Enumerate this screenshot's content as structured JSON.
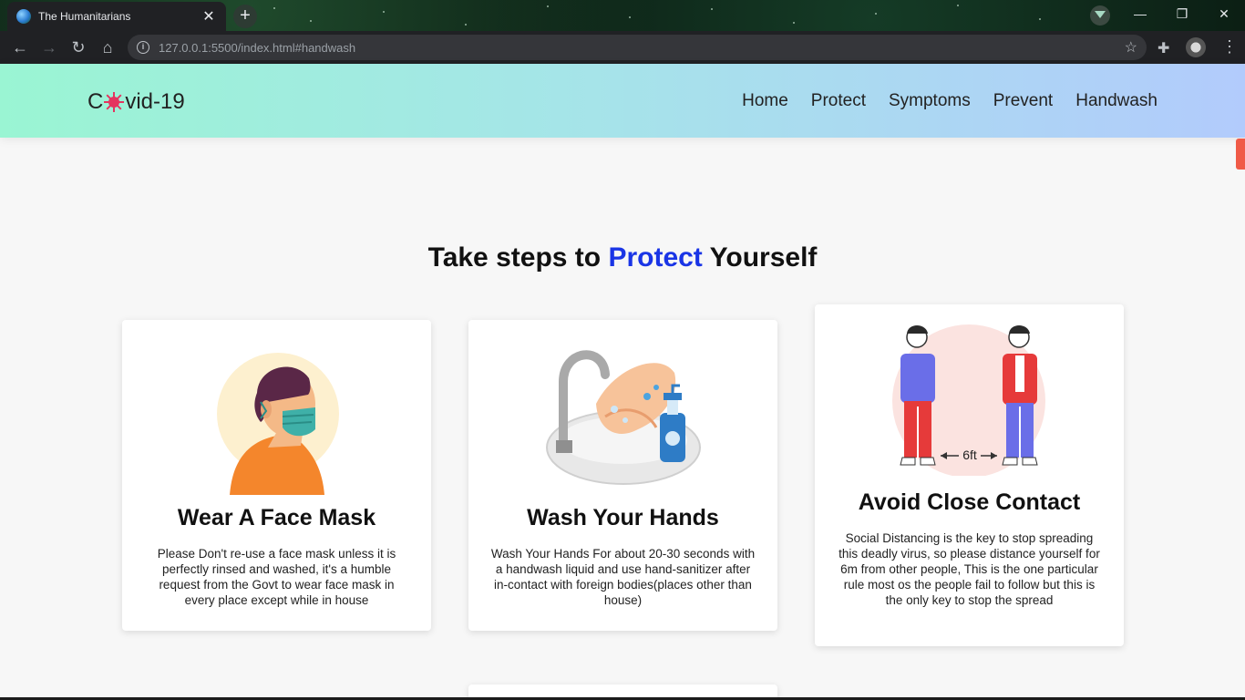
{
  "browser": {
    "tab_title": "The Humanitarians",
    "tab_close": "✕",
    "new_tab": "+",
    "url": "127.0.0.1:5500/index.html#handwash",
    "minimize": "—",
    "restore": "❐",
    "close": "✕"
  },
  "site": {
    "logo_prefix": "C",
    "logo_suffix": "vid-19",
    "nav": [
      "Home",
      "Protect",
      "Symptoms",
      "Prevent",
      "Handwash"
    ]
  },
  "heading": {
    "before": "Take steps to ",
    "accent": "Protect",
    "after": " Yourself",
    "accent_color": "#1a35e6"
  },
  "cards": [
    {
      "title": "Wear A Face Mask",
      "text": "Please Don't re-use a face mask unless it is perfectly rinsed and washed, it's a humble request from the Govt to wear face mask in every place except while in house",
      "icon": "face-mask-illustration"
    },
    {
      "title": "Wash Your Hands",
      "text": "Wash Your Hands For about 20-30 seconds with a handwash liquid and use hand-sanitizer after in-contact with foreign bodies(places other than house)",
      "icon": "handwash-illustration"
    },
    {
      "title": "Avoid Close Contact",
      "text": "Social Distancing is the key to stop spreading this deadly virus, so please distance yourself for 6m from other people, This is the one particular rule most os the people fail to follow but this is the only key to stop the spread",
      "icon": "social-distance-illustration",
      "distance_label": "6ft"
    }
  ]
}
